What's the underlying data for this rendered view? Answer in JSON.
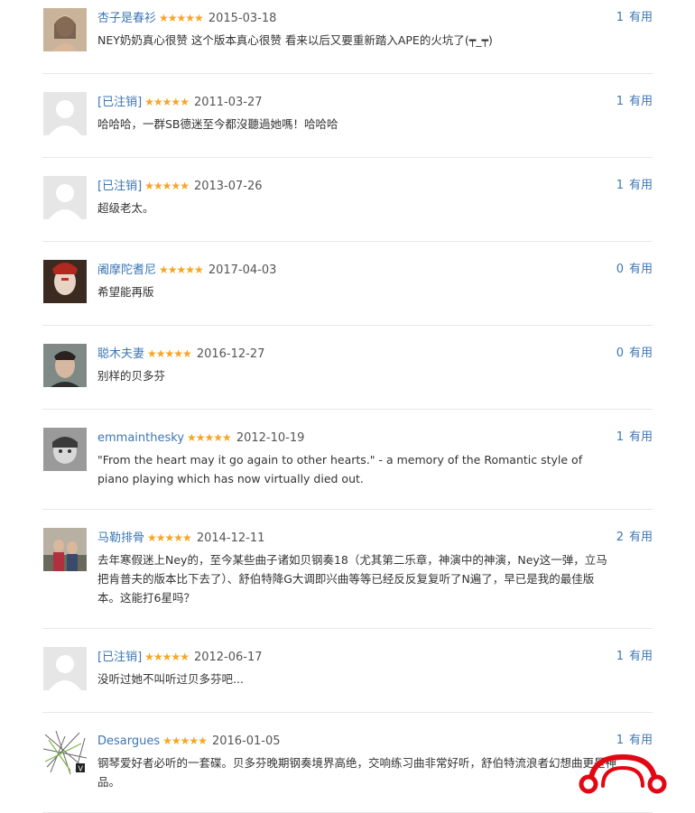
{
  "useful_label": "有用",
  "colors": {
    "link": "#3d77b4",
    "star": "#f5a623",
    "divider": "#e8e8e8",
    "logo": "#e30613"
  },
  "comments": [
    {
      "user": "杏子是春衫",
      "stars": "★★★★★",
      "date": "2015-03-18",
      "useful": "1",
      "text": "NEY奶奶真心很赞 这个版本真心很赞 看来以后又要重新踏入APE的火坑了(┯_┯)",
      "avatar": "user-photo-icon"
    },
    {
      "user": "[已注销]",
      "stars": "★★★★★",
      "date": "2011-03-27",
      "useful": "1",
      "text": "哈哈哈，一群SB德迷至今都沒聽過她嗎！哈哈哈",
      "avatar": "default-avatar-icon"
    },
    {
      "user": "[已注销]",
      "stars": "★★★★★",
      "date": "2013-07-26",
      "useful": "1",
      "text": "超级老太。",
      "avatar": "default-avatar-icon"
    },
    {
      "user": "阇摩陀耆尼",
      "stars": "★★★★★",
      "date": "2017-04-03",
      "useful": "0",
      "text": "希望能再版",
      "avatar": "user-photo-icon"
    },
    {
      "user": "聪木夫妻",
      "stars": "★★★★★",
      "date": "2016-12-27",
      "useful": "0",
      "text": "别样的贝多芬",
      "avatar": "user-photo-icon"
    },
    {
      "user": "emmainthesky",
      "stars": "★★★★★",
      "date": "2012-10-19",
      "useful": "1",
      "text": "\"From the heart may it go again to other hearts.\" - a memory of the Romantic style of piano playing which has now virtually died out.",
      "avatar": "user-photo-icon"
    },
    {
      "user": "马勒排骨",
      "stars": "★★★★★",
      "date": "2014-12-11",
      "useful": "2",
      "text": "去年寒假迷上Ney的，至今某些曲子诸如贝钢奏18（尤其第二乐章，神演中的神演，Ney这一弹，立马把肯普夫的版本比下去了）、舒伯特降G大调即兴曲等等已经反反复复听了N遍了，早已是我的最佳版本。这能打6星吗？",
      "avatar": "user-photo-icon"
    },
    {
      "user": "[已注销]",
      "stars": "★★★★★",
      "date": "2012-06-17",
      "useful": "1",
      "text": "没听过她不叫听过贝多芬吧...",
      "avatar": "default-avatar-icon"
    },
    {
      "user": "Desargues",
      "stars": "★★★★★",
      "date": "2016-01-05",
      "useful": "1",
      "text": "钢琴爱好者必听的一套碟。贝多芬晚期钢奏境界高绝，交响练习曲非常好听，舒伯特流浪者幻想曲更是神品。",
      "avatar": "user-photo-icon"
    }
  ],
  "logo": {
    "name": "headphones-logo-icon"
  }
}
